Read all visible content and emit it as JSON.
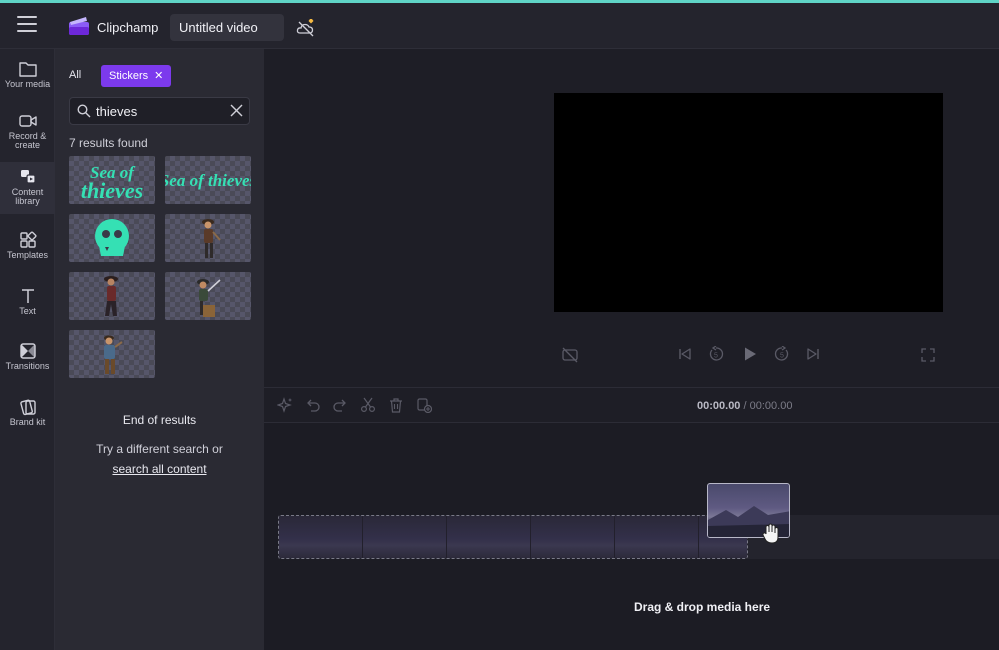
{
  "app": {
    "brand": "Clipchamp",
    "project_title": "Untitled video"
  },
  "nav": {
    "items": [
      {
        "label": "Your media",
        "icon": "folder-icon"
      },
      {
        "label": "Record & create",
        "icon": "camera-icon"
      },
      {
        "label": "Content library",
        "icon": "content-library-icon",
        "active": true
      },
      {
        "label": "Templates",
        "icon": "templates-icon"
      },
      {
        "label": "Text",
        "icon": "text-icon"
      },
      {
        "label": "Transitions",
        "icon": "transitions-icon"
      },
      {
        "label": "Brand kit",
        "icon": "brand-kit-icon"
      }
    ]
  },
  "library": {
    "filter_all": "All",
    "filter_active": "Stickers",
    "search_value": "thieves",
    "results_count": "7 results found",
    "results": [
      {
        "name": "sea-of-thieves-logo-stacked"
      },
      {
        "name": "sea-of-thieves-logo-wide"
      },
      {
        "name": "sea-of-thieves-skull"
      },
      {
        "name": "pirate-character-1"
      },
      {
        "name": "pirate-character-2"
      },
      {
        "name": "pirate-character-3"
      },
      {
        "name": "pirate-character-4"
      }
    ],
    "end_text": "End of results",
    "try_text": "Try a different search or",
    "search_all_link": "search all content"
  },
  "timeline": {
    "current_time": "00:00.00",
    "total_time": "/ 00:00.00",
    "drop_hint": "Drag & drop media here"
  },
  "colors": {
    "accent": "#7c3aed",
    "teal_border": "#5fd4c6",
    "sea_green": "#35e0b4"
  }
}
